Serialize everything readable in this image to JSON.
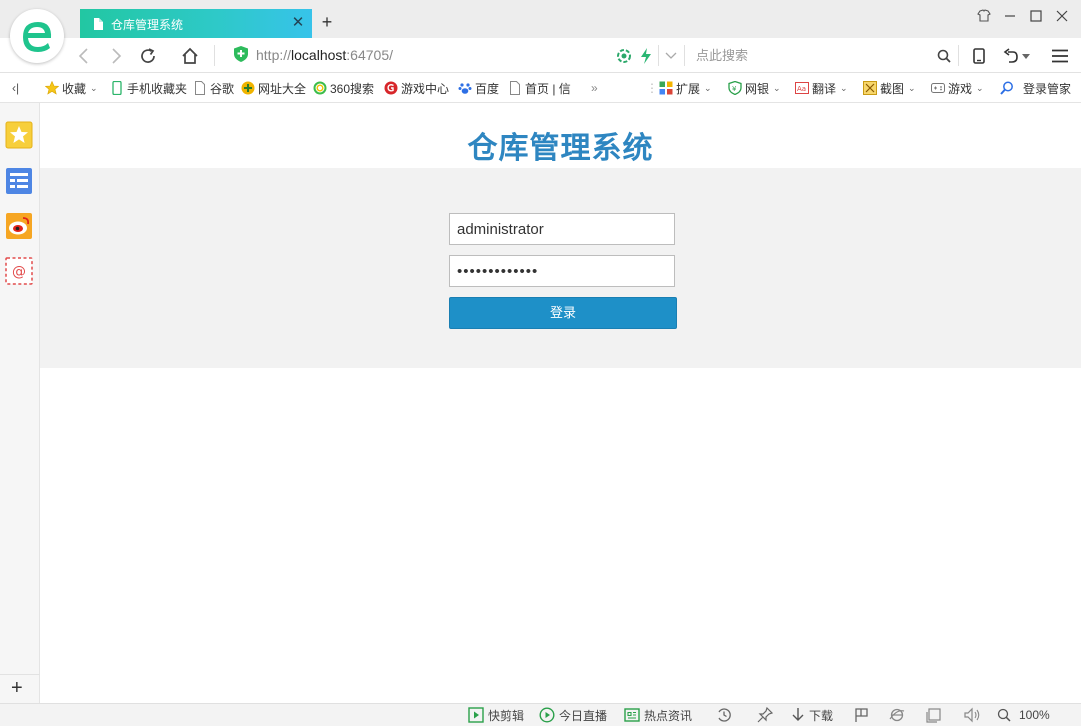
{
  "browser": {
    "tab_title": "仓库管理系统",
    "tab_close": "✕",
    "new_tab": "+",
    "url_prefix": "http://",
    "url_host": "localhost",
    "url_suffix": ":64705/",
    "search_placeholder": "点此搜索"
  },
  "bookmarks": {
    "collapse": "‹|",
    "favorites": "收藏",
    "items": [
      "手机收藏夹",
      "谷歌",
      "网址大全",
      "360搜索",
      "游戏中心",
      "百度",
      "首页 | 信"
    ],
    "more": "»",
    "tools": [
      "扩展",
      "网银",
      "翻译",
      "截图",
      "游戏",
      "登录管家"
    ]
  },
  "page": {
    "title": "仓库管理系统",
    "username_value": "administrator",
    "password_value": "•••••••••••••",
    "login_label": "登录"
  },
  "statusbar": {
    "items": [
      "快剪辑",
      "今日直播",
      "热点资讯"
    ],
    "download": "下载",
    "zoom": "100%"
  },
  "colors": {
    "accent": "#1e90c8",
    "title": "#2e86c1",
    "tab_gradient_start": "#22c7a2",
    "tab_gradient_end": "#37c3ea",
    "panel_bg": "#f2f2f2"
  }
}
